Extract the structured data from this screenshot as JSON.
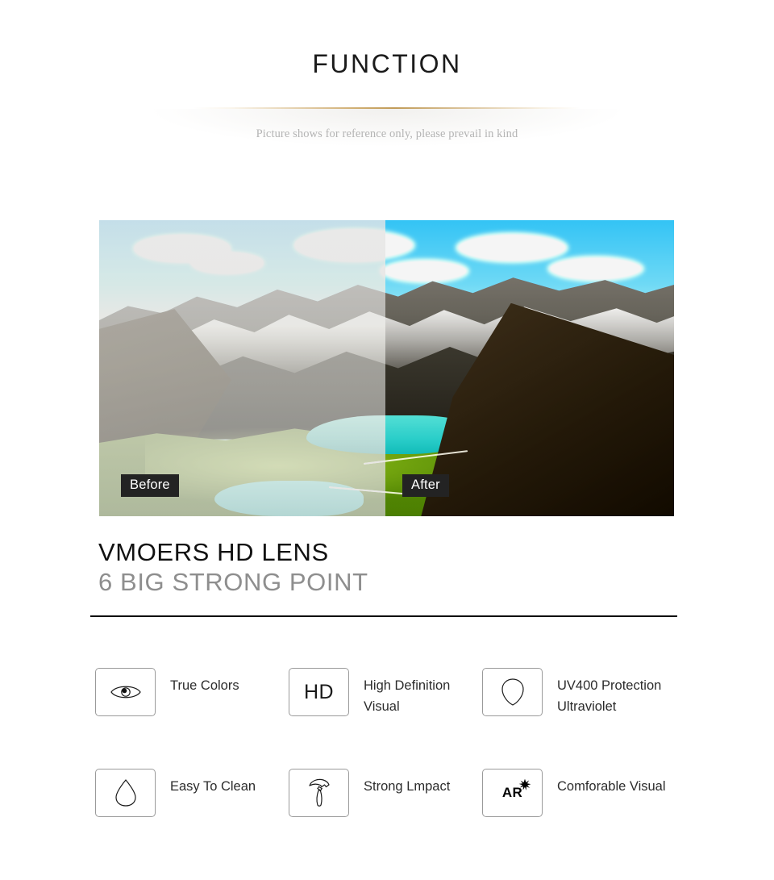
{
  "header": {
    "title": "FUNCTION",
    "subtitle": "Picture shows for reference only, please prevail in kind",
    "divider_color": "#c8a05a"
  },
  "comparison": {
    "before_label": "Before",
    "after_label": "After",
    "label_bg": "#232323",
    "label_color": "#ffffff",
    "description": "Split mountain landscape photo: hazy washed-out half on the left, vivid saturated half on the right"
  },
  "headline": {
    "line1": "VMOERS HD LENS",
    "line2": "6 BIG STRONG POINT",
    "line1_color": "#111111",
    "line2_color": "#8e8e8e"
  },
  "features": [
    {
      "icon": "eye-icon",
      "label": "True Colors",
      "icon_text": ""
    },
    {
      "icon": "hd-icon",
      "label": "High Definition\nVisual",
      "icon_text": "HD"
    },
    {
      "icon": "shield-icon",
      "label": "UV400 Protection\nUltraviolet",
      "icon_text": ""
    },
    {
      "icon": "droplet-icon",
      "label": "Easy To Clean",
      "icon_text": ""
    },
    {
      "icon": "hammer-icon",
      "label": "Strong Lmpact",
      "icon_text": ""
    },
    {
      "icon": "ar-star-icon",
      "label": "Comforable Visual",
      "icon_text": "AR"
    }
  ]
}
